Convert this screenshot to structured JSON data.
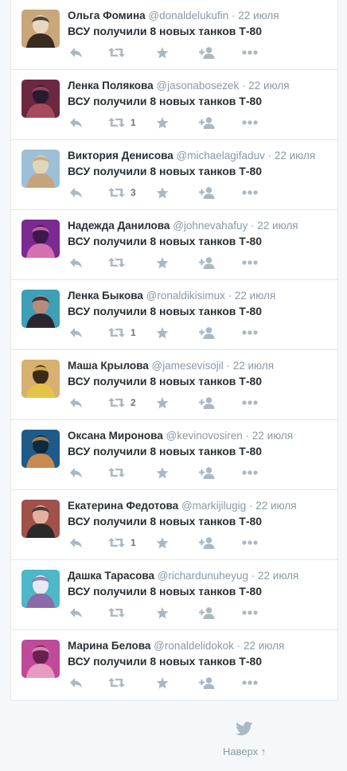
{
  "tweets": [
    {
      "fullname": "Ольга Фомина",
      "username": "@donaldelukufin",
      "time": "22 июля",
      "text": "ВСУ получили 8 новых танков Т-80",
      "retweets": "",
      "avatar_colors": [
        "#c9a77b",
        "#3a2b22",
        "#e8d8c0"
      ]
    },
    {
      "fullname": "Ленка Полякова",
      "username": "@jasonabosezek",
      "time": "22 июля",
      "text": "ВСУ получили 8 новых танков Т-80",
      "retweets": "1",
      "avatar_colors": [
        "#6b2840",
        "#a84a5e",
        "#2a1a30"
      ]
    },
    {
      "fullname": "Виктория Денисова",
      "username": "@michaelagifaduv",
      "time": "22 июля",
      "text": "ВСУ получили 8 новых танков Т-80",
      "retweets": "3",
      "avatar_colors": [
        "#9bc0d8",
        "#c8a37a",
        "#e2d6b8"
      ]
    },
    {
      "fullname": "Надежда Данилова",
      "username": "@johnevahafuy",
      "time": "22 июля",
      "text": "ВСУ получили 8 новых танков Т-80",
      "retweets": "",
      "avatar_colors": [
        "#7a2a90",
        "#d66fb0",
        "#3a1a4a"
      ]
    },
    {
      "fullname": "Ленка Быкова",
      "username": "@ronaldikisimux",
      "time": "22 июля",
      "text": "ВСУ получили 8 новых танков Т-80",
      "retweets": "1",
      "avatar_colors": [
        "#3f9fb6",
        "#2b2530",
        "#b88b7c"
      ]
    },
    {
      "fullname": "Маша Крылова",
      "username": "@jamesevisojil",
      "time": "22 июля",
      "text": "ВСУ получили 8 новых танков Т-80",
      "retweets": "2",
      "avatar_colors": [
        "#d8b070",
        "#e6c24a",
        "#3a2a1a"
      ]
    },
    {
      "fullname": "Оксана Миронова",
      "username": "@kevinovosiren",
      "time": "22 июля",
      "text": "ВСУ получили 8 новых танков Т-80",
      "retweets": "",
      "avatar_colors": [
        "#1e5a8a",
        "#c98a50",
        "#0e2a40"
      ]
    },
    {
      "fullname": "Екатерина Федотова",
      "username": "@markijilugig",
      "time": "22 июля",
      "text": "ВСУ получили 8 новых танков Т-80",
      "retweets": "1",
      "avatar_colors": [
        "#a0524a",
        "#2a2a2a",
        "#e6b0a0"
      ]
    },
    {
      "fullname": "Дашка Тарасова",
      "username": "@richardunuheyug",
      "time": "22 июля",
      "text": "ВСУ получили 8 новых танков Т-80",
      "retweets": "",
      "avatar_colors": [
        "#4cb8c8",
        "#8a6aa8",
        "#e8e8f0"
      ]
    },
    {
      "fullname": "Марина Белова",
      "username": "@ronaldelidokok",
      "time": "22 июля",
      "text": "ВСУ получили 8 новых танков Т-80",
      "retweets": "",
      "avatar_colors": [
        "#c04a9a",
        "#e89ac0",
        "#6a2050"
      ]
    }
  ],
  "footer": {
    "back_to_top": "Наверх ↑"
  },
  "colors": {
    "icon": "#aab8c2",
    "text": "#292f33",
    "meta": "#8899a6",
    "border": "#e1e8ed",
    "background": "#f5f8fa"
  },
  "icons": [
    "reply-icon",
    "retweet-icon",
    "favorite-icon",
    "follow-icon",
    "more-icon",
    "twitter-bird-icon"
  ]
}
